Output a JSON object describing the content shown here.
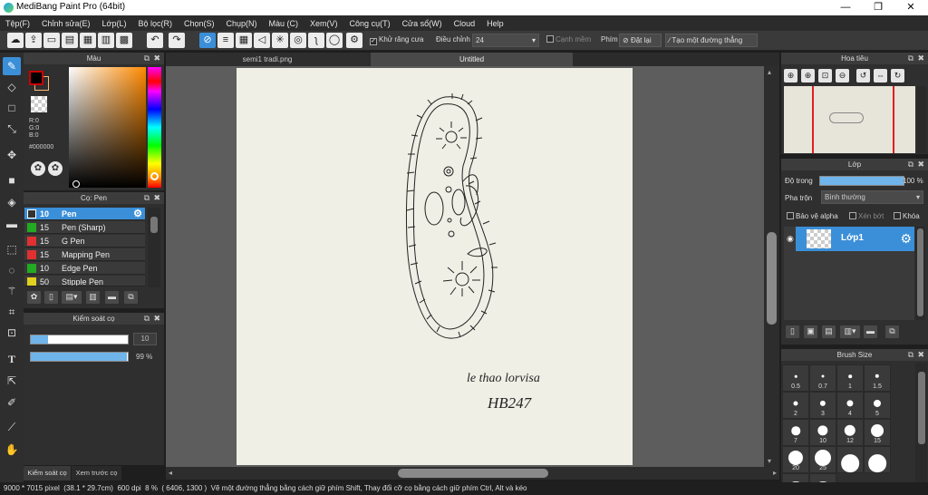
{
  "app": {
    "title": "MediBang Paint Pro (64bit)"
  },
  "window": {
    "minimize": "—",
    "restore": "❐",
    "close": "✕"
  },
  "menu": [
    "Tệp(F)",
    "Chỉnh sửa(E)",
    "Lớp(L)",
    "Bộ lọc(R)",
    "Chọn(S)",
    "Chụp(N)",
    "Màu (C)",
    "Xem(V)",
    "Công cụ(T)",
    "Cửa sổ(W)",
    "Cloud",
    "Help"
  ],
  "toolbar": {
    "antialias_label": "Khử răng cưa",
    "adjust_label": "Điều chỉnh",
    "adjust_value": "24",
    "edge_label": "Cạnh mềm",
    "key_label": "Phím",
    "reset_label": "Đặt lại",
    "line_label": "Tạo một đường thẳng"
  },
  "color_panel": {
    "title": "Màu",
    "r": "R:0",
    "g": "G:0",
    "b": "B:0",
    "hex": "#000000",
    "foreground": "#000000",
    "background": "#ffb878"
  },
  "brush_panel": {
    "title": "Cọ: Pen",
    "items": [
      {
        "size": "10",
        "name": "Pen",
        "color": "#333333",
        "selected": true
      },
      {
        "size": "15",
        "name": "Pen (Sharp)",
        "color": "#22aa22"
      },
      {
        "size": "15",
        "name": "G Pen",
        "color": "#e03030"
      },
      {
        "size": "15",
        "name": "Mapping Pen",
        "color": "#e03030"
      },
      {
        "size": "10",
        "name": "Edge Pen",
        "color": "#22aa22"
      },
      {
        "size": "50",
        "name": "Stipple Pen",
        "color": "#e0d020"
      }
    ]
  },
  "brush_control": {
    "title": "Kiểm soát cọ",
    "size_value": "10",
    "size_fraction": 0.18,
    "opacity_label": "99 %",
    "opacity_fraction": 0.99
  },
  "bottom_tabs": [
    "Kiểm soát cọ",
    "Xem trước cọ"
  ],
  "doc_tabs": [
    "semi1 tradi.png",
    "Untitled"
  ],
  "drawing_text": {
    "line1": "le thao lorvisa",
    "line2": "HB247"
  },
  "navigator": {
    "title": "Hoa tiêu"
  },
  "layer_panel": {
    "title": "Lớp",
    "opacity_label": "Độ trong",
    "opacity_value": "100 %",
    "opacity_fraction": 1.0,
    "blend_label": "Pha trộn",
    "blend_value": "Bình thường",
    "protect_alpha": "Bảo vệ alpha",
    "clip": "Xén bớt",
    "lock": "Khóa",
    "layer_name": "Lớp1"
  },
  "brush_size_panel": {
    "title": "Brush Size",
    "sizes": [
      "0.5",
      "0.7",
      "1",
      "1.5",
      "2",
      "3",
      "4",
      "5",
      "7",
      "10",
      "12",
      "15",
      "20",
      "25",
      "",
      "",
      "",
      ""
    ]
  },
  "status": {
    "dims": "9000 * 7015 pixel",
    "cm": "(38.1 * 29.7cm)",
    "dpi": "600 dpi",
    "zoom": "8 %",
    "coords": "( 6406, 1300 )",
    "hint": "Vẽ một đường thẳng bằng cách giữ phím Shift, Thay đổi cỡ cọ bằng cách giữ phím Ctrl, Alt và kéo"
  }
}
